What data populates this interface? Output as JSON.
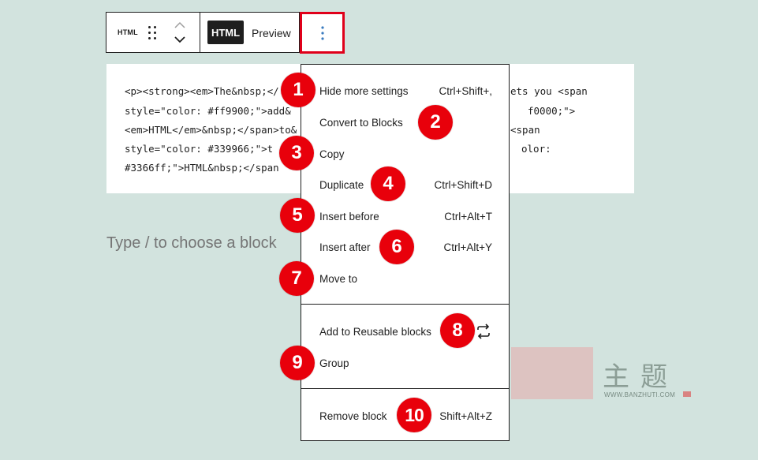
{
  "toolbar": {
    "block_type_label": "HTML",
    "tab_html": "HTML",
    "tab_preview": "Preview"
  },
  "code": {
    "lines": [
      "<p><strong><em>The&nbsp;</",
      "style=\"color: #ff9900;\">add&",
      "<em>HTML</em>&nbsp;</span>to&",
      "style=\"color: #339966;\">t",
      "#3366ff;\">HTML&nbsp;</span"
    ],
    "right_lines": [
      "ets you <span",
      "f0000;\">",
      "<span",
      "olor:"
    ]
  },
  "placeholder": "Type / to choose a block",
  "menu": {
    "items": [
      {
        "label": "Hide more settings",
        "shortcut": "Ctrl+Shift+,",
        "badge": "1"
      },
      {
        "label": "Convert to Blocks",
        "shortcut": "",
        "badge": "2"
      },
      {
        "label": "Copy",
        "shortcut": "",
        "badge": "3"
      },
      {
        "label": "Duplicate",
        "shortcut": "Ctrl+Shift+D",
        "badge": "4"
      },
      {
        "label": "Insert before",
        "shortcut": "Ctrl+Alt+T",
        "badge": "5"
      },
      {
        "label": "Insert after",
        "shortcut": "Ctrl+Alt+Y",
        "badge": "6"
      },
      {
        "label": "Move to",
        "shortcut": "",
        "badge": "7"
      },
      {
        "label": "Add to Reusable blocks",
        "shortcut": "",
        "badge": "8"
      },
      {
        "label": "Group",
        "shortcut": "",
        "badge": "9"
      },
      {
        "label": "Remove block",
        "shortcut": "Shift+Alt+Z",
        "badge": "10"
      }
    ]
  },
  "watermark": {
    "main": "主题",
    "url": "WWW.BANZHUTI.COM"
  },
  "colors": {
    "background": "#d2e3de",
    "highlight_border": "#e0001a",
    "badge": "#e8000b",
    "text": "#1e1e1e",
    "placeholder": "#757575"
  },
  "icons": {
    "drag_handle": "drag-handle-icon",
    "mover": "chevron-up-down-icon",
    "options": "vertical-ellipsis-icon",
    "reusable": "reusable-block-icon"
  }
}
